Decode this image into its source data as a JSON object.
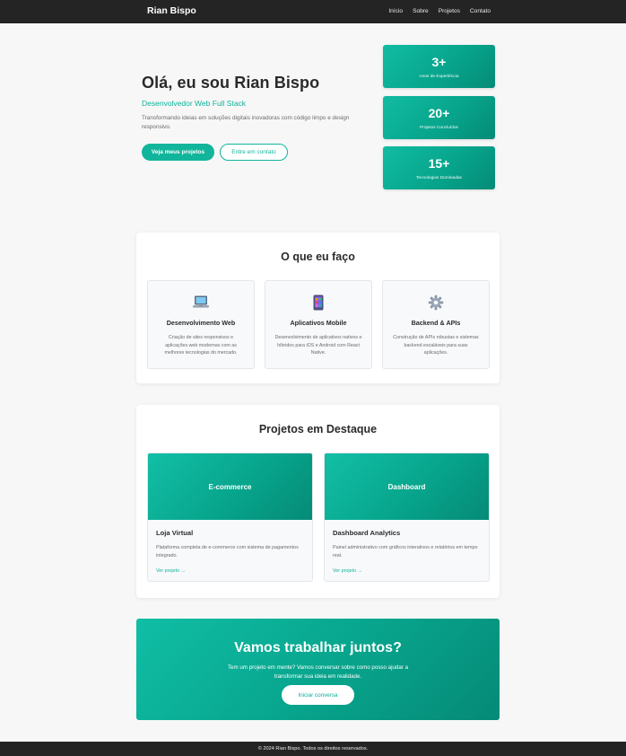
{
  "header": {
    "brand": "Rian Bispo",
    "nav": [
      "Início",
      "Sobre",
      "Projetos",
      "Contato"
    ]
  },
  "hero": {
    "title": "Olá, eu sou Rian Bispo",
    "subtitle": "Desenvolvedor Web Full Stack",
    "description": "Transformando ideias em soluções digitais inovadoras com código limpo e design responsivo.",
    "primary_button": "Veja meus projetos",
    "secondary_button": "Entre em contato"
  },
  "stats": [
    {
      "value": "3+",
      "label": "Anos de Experiência"
    },
    {
      "value": "20+",
      "label": "Projetos Concluídos"
    },
    {
      "value": "15+",
      "label": "Tecnologias Dominadas"
    }
  ],
  "services": {
    "title": "O que eu faço",
    "items": [
      {
        "icon": "laptop-icon",
        "title": "Desenvolvimento Web",
        "description": "Criação de sites responsivos e aplicações web modernas com as melhores tecnologias do mercado."
      },
      {
        "icon": "smartphone-icon",
        "title": "Aplicativos Mobile",
        "description": "Desenvolvimento de aplicativos nativos e híbridos para iOS e Android com React Native."
      },
      {
        "icon": "gear-icon",
        "title": "Backend & APIs",
        "description": "Construção de APIs robustas e sistemas backend escaláveis para suas aplicações."
      }
    ]
  },
  "projects": {
    "title": "Projetos em Destaque",
    "items": [
      {
        "banner": "E-commerce",
        "name": "Loja Virtual",
        "description": "Plataforma completa de e-commerce com sistema de pagamentos integrado.",
        "link": "Ver projeto →"
      },
      {
        "banner": "Dashboard",
        "name": "Dashboard Analytics",
        "description": "Painel administrativo com gráficos interativos e relatórios em tempo real.",
        "link": "Ver projeto →"
      }
    ]
  },
  "cta": {
    "title": "Vamos trabalhar juntos?",
    "description": "Tem um projeto em mente? Vamos conversar sobre como posso ajudar a transformar sua ideia em realidade.",
    "button": "Iniciar conversa"
  },
  "footer": {
    "text": "© 2024 Rian Bispo. Todos os direitos reservados."
  },
  "colors": {
    "accent": "#11b59b",
    "header_bg": "#242424"
  }
}
